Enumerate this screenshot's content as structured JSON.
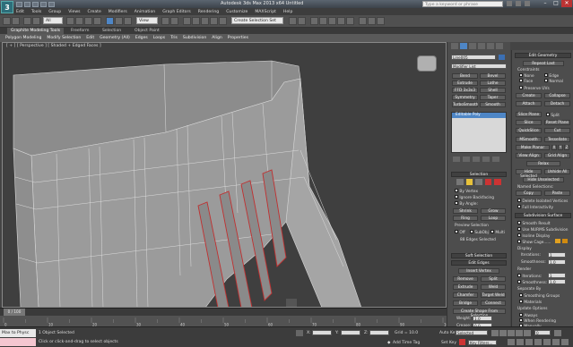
{
  "titlebar": {
    "title": "Autodesk 3ds Max 2013 x64   Untitled",
    "search_placeholder": "Type a keyword or phrase",
    "help": "Help",
    "minimize": "–",
    "maximize": "□",
    "close": "✕"
  },
  "menu": [
    "Edit",
    "Tools",
    "Group",
    "Views",
    "Create",
    "Modifiers",
    "Animation",
    "Graph Editors",
    "Rendering",
    "Customize",
    "MAXScript",
    "Help"
  ],
  "toolbar": {
    "selection_filter": "All",
    "reference_coord": "View",
    "named_selection": "Create Selection Set"
  },
  "ribbon_tabs": [
    "Graphite Modeling Tools",
    "Freeform",
    "Selection",
    "Object Paint"
  ],
  "ribbon_items": [
    "Polygon Modeling",
    "Modify Selection",
    "Edit",
    "Geometry (All)",
    "Edges",
    "Loops",
    "Tris",
    "Subdivision",
    "Align",
    "Properties"
  ],
  "viewport": {
    "label": "[ + ] [ Perspective ] [ Shaded + Edged Faces ]"
  },
  "command_panel": {
    "object_name": "Line005",
    "modifier_list": "Modifier List",
    "mod_buttons": [
      "Bend",
      "Bevel",
      "Extrude",
      "Lathe",
      "FFD 3x3x3",
      "Shell",
      "Symmetry",
      "Taper",
      "TurboSmooth",
      "Smooth"
    ],
    "stack_item": "Editable Poly",
    "selection_header": "Selection",
    "by_vertex": "By Vertex",
    "ignore_backfacing": "Ignore Backfacing",
    "by_angle": "By Angle:",
    "shrink": "Shrink",
    "grow": "Grow",
    "ring": "Ring",
    "loop": "Loop",
    "preview_selection": "Preview Selection",
    "off": "Off",
    "subobj": "SubObj",
    "multi": "Multi",
    "edges_selected": "88 Edges Selected",
    "soft_selection": "Soft Selection",
    "edit_edges": "Edit Edges",
    "insert_vertex": "Insert Vertex",
    "remove": "Remove",
    "split": "Split",
    "extrude": "Extrude",
    "weld": "Weld",
    "chamfer": "Chamfer",
    "target_weld": "Target Weld",
    "bridge": "Bridge",
    "connect": "Connect",
    "create_shape": "Create Shape From Selection",
    "weight": "Weight:",
    "weight_val": "1.0",
    "crease": "Crease:",
    "crease_val": "0.0"
  },
  "edit_panel": {
    "edit_geometry": "Edit Geometry",
    "repeat_last": "Repeat Last",
    "constraints": "Constraints",
    "none": "None",
    "edge": "Edge",
    "face": "Face",
    "normal": "Normal",
    "preserve_uvs": "Preserve UVs",
    "create": "Create",
    "collapse": "Collapse",
    "attach": "Attach",
    "detach": "Detach",
    "slice_plane": "Slice Plane",
    "split": "Split",
    "slice": "Slice",
    "reset_plane": "Reset Plane",
    "quickslice": "QuickSlice",
    "cut": "Cut",
    "msmooth": "MSmooth",
    "tessellate": "Tessellate",
    "make_planar": "Make Planar",
    "x": "X",
    "y": "Y",
    "z": "Z",
    "view_align": "View Align",
    "grid_align": "Grid Align",
    "relax": "Relax",
    "hide_selected": "Hide Selected",
    "unhide_all": "Unhide All",
    "hide_unselected": "Hide Unselected",
    "named_selections": "Named Selections:",
    "copy": "Copy",
    "paste": "Paste",
    "delete_isolated": "Delete Isolated Vertices",
    "full_interactivity": "Full Interactivity",
    "subdivision_surface": "Subdivision Surface",
    "smooth_result": "Smooth Result",
    "use_nurms": "Use NURMS Subdivision",
    "isoline_display": "Isoline Display",
    "show_cage": "Show Cage......",
    "display": "Display",
    "iterations": "Iterations:",
    "iterations_val": "1",
    "smoothness": "Smoothness:",
    "smoothness_val": "1.0",
    "render": "Render",
    "separate_by": "Separate By",
    "smoothing_groups": "Smoothing Groups",
    "materials": "Materials",
    "update_options": "Update Options",
    "always": "Always",
    "when_rendering": "When Rendering",
    "manually": "Manually"
  },
  "timeline": {
    "slider": "0 / 100",
    "ticks": [
      "0",
      "10",
      "20",
      "30",
      "40",
      "50",
      "60",
      "70",
      "80",
      "90",
      "100"
    ]
  },
  "status": {
    "maxscript": "Max to Physc",
    "selected": "1 Object Selected",
    "prompt": "Click or click-and-drag to select objects",
    "x_label": "X:",
    "y_label": "Y:",
    "z_label": "Z:",
    "grid": "Grid = 10.0",
    "auto_key": "Auto Key",
    "auto_key_val": "Selected",
    "set_key": "Set Key",
    "key_filters": "Key Filters...",
    "add_time_tag": "Add Time Tag",
    "frame": "0"
  },
  "colors": {
    "accent": "#4e86c6",
    "selected_edges": "#c03030",
    "key_red": "#c33",
    "cage_orange": "#e0a020"
  }
}
